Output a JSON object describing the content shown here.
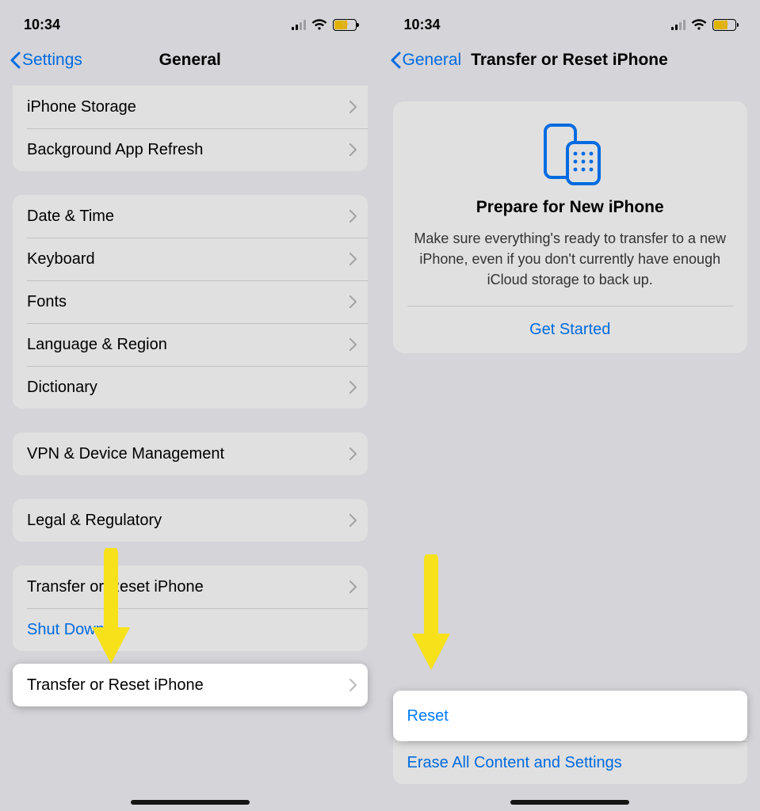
{
  "status": {
    "time": "10:34"
  },
  "left": {
    "back": "Settings",
    "title": "General",
    "rows_g1": [
      "iPhone Storage",
      "Background App Refresh"
    ],
    "rows_g2": [
      "Date & Time",
      "Keyboard",
      "Fonts",
      "Language & Region",
      "Dictionary"
    ],
    "rows_g3": [
      "VPN & Device Management"
    ],
    "rows_g4": [
      "Legal & Regulatory"
    ],
    "highlight_row": "Transfer or Reset iPhone",
    "shutdown": "Shut Down"
  },
  "right": {
    "back": "General",
    "title": "Transfer or Reset iPhone",
    "card_title": "Prepare for New iPhone",
    "card_body": "Make sure everything's ready to transfer to a new iPhone, even if you don't currently have enough iCloud storage to back up.",
    "card_action": "Get Started",
    "reset": "Reset",
    "erase": "Erase All Content and Settings"
  },
  "colors": {
    "accent": "#007aff",
    "arrow": "#f7e11b"
  }
}
